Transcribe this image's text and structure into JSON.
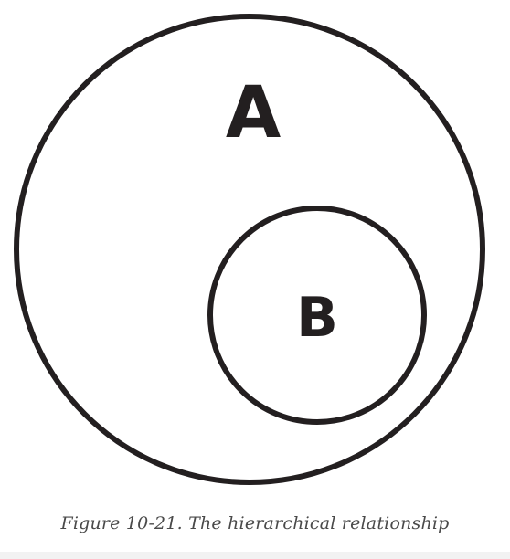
{
  "diagram": {
    "outer_set_label": "A",
    "inner_set_label": "B"
  },
  "caption": "Figure 10-21. The hierarchical relationship",
  "colors": {
    "stroke": "#231f20",
    "caption_text": "#4a4a4a",
    "background": "#ffffff"
  }
}
